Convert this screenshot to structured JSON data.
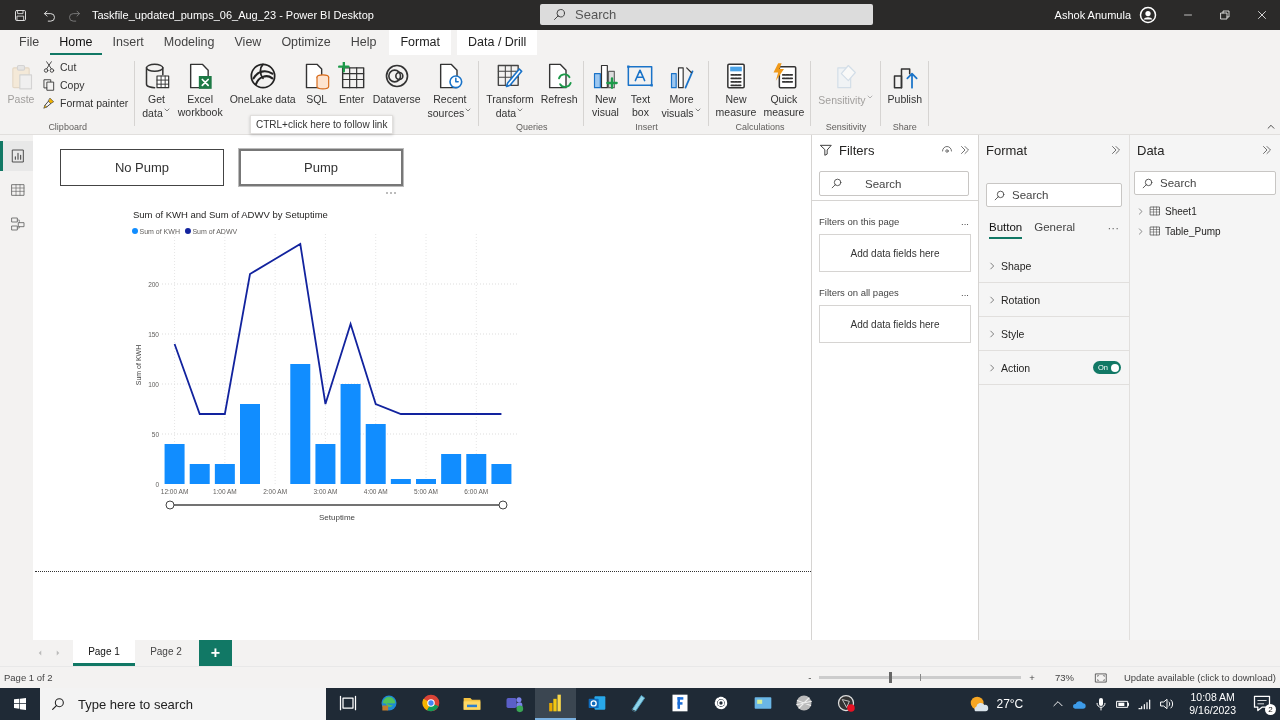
{
  "window": {
    "title": "Taskfile_updated_pumps_06_Aug_23 - Power BI Desktop",
    "search_placeholder": "Search",
    "user": "Ashok Anumula"
  },
  "menu_tabs": [
    {
      "label": "File",
      "selected": false,
      "kind": "plain"
    },
    {
      "label": "Home",
      "selected": true,
      "kind": "plain"
    },
    {
      "label": "Insert",
      "selected": false,
      "kind": "plain"
    },
    {
      "label": "Modeling",
      "selected": false,
      "kind": "plain"
    },
    {
      "label": "View",
      "selected": false,
      "kind": "plain"
    },
    {
      "label": "Optimize",
      "selected": false,
      "kind": "plain"
    },
    {
      "label": "Help",
      "selected": false,
      "kind": "plain"
    },
    {
      "label": "Format",
      "selected": false,
      "kind": "contextual"
    },
    {
      "label": "Data / Drill",
      "selected": false,
      "kind": "contextual"
    }
  ],
  "ribbon": {
    "groups": [
      {
        "label": "Clipboard",
        "buttons": [
          {
            "label": "Paste",
            "kind": "large",
            "disabled": true,
            "dropdown": false
          },
          {
            "label": "Cut",
            "kind": "small",
            "disabled": false,
            "dropdown": false
          },
          {
            "label": "Copy",
            "kind": "small",
            "disabled": false,
            "dropdown": false
          },
          {
            "label": "Format painter",
            "kind": "small",
            "disabled": false,
            "dropdown": false
          }
        ]
      },
      {
        "buttons": [
          {
            "label": "Get\ndata",
            "kind": "large",
            "disabled": false,
            "dropdown": true
          },
          {
            "label": "Excel\nworkbook",
            "kind": "large",
            "disabled": false,
            "dropdown": false
          },
          {
            "label": "OneLake data",
            "kind": "large",
            "disabled": false,
            "dropdown": false
          },
          {
            "label": "SQL",
            "kind": "large",
            "disabled": false,
            "dropdown": false
          },
          {
            "label": "Enter",
            "kind": "large",
            "disabled": false,
            "dropdown": false
          },
          {
            "label": "Dataverse",
            "kind": "large",
            "disabled": false,
            "dropdown": false
          },
          {
            "label": "Recent\nsources",
            "kind": "large",
            "disabled": false,
            "dropdown": true
          }
        ]
      },
      {
        "label": "Queries",
        "buttons": [
          {
            "label": "Transform\ndata",
            "kind": "large",
            "disabled": false,
            "dropdown": true
          },
          {
            "label": "Refresh",
            "kind": "large",
            "disabled": false,
            "dropdown": false
          }
        ]
      },
      {
        "label": "Insert",
        "buttons": [
          {
            "label": "New\nvisual",
            "kind": "large",
            "disabled": false,
            "dropdown": false
          },
          {
            "label": "Text\nbox",
            "kind": "large",
            "disabled": false,
            "dropdown": false
          },
          {
            "label": "More\nvisuals",
            "kind": "large",
            "disabled": false,
            "dropdown": true
          }
        ]
      },
      {
        "label": "Calculations",
        "buttons": [
          {
            "label": "New\nmeasure",
            "kind": "large",
            "disabled": false,
            "dropdown": false
          },
          {
            "label": "Quick\nmeasure",
            "kind": "large",
            "disabled": false,
            "dropdown": false
          }
        ]
      },
      {
        "label": "Sensitivity",
        "buttons": [
          {
            "label": "Sensitivity",
            "kind": "large",
            "disabled": true,
            "dropdown": true
          }
        ]
      },
      {
        "label": "Share",
        "buttons": [
          {
            "label": "Publish",
            "kind": "large",
            "disabled": false,
            "dropdown": false
          }
        ]
      }
    ]
  },
  "tooltip": "CTRL+click here to follow link",
  "views": [
    {
      "selected": true
    },
    {
      "selected": false
    },
    {
      "selected": false
    }
  ],
  "report": {
    "buttons": [
      {
        "label": "No Pump",
        "selected": false
      },
      {
        "label": "Pump",
        "selected": true
      }
    ],
    "chart": {
      "chart_data": {
        "type": "bar",
        "title": "Sum of KWH and Sum of ADWV by Setuptime",
        "xlabel": "Setuptime",
        "ylabel": "Sum of KWH",
        "x": [
          0,
          30,
          60,
          90,
          120,
          150,
          180,
          210,
          240,
          270,
          300,
          330,
          360,
          390
        ],
        "series": [
          {
            "name": "Sum of KWH",
            "type": "bar",
            "color": "#118dff",
            "values": [
              40,
              20,
              20,
              80,
              null,
              120,
              40,
              100,
              60,
              5,
              5,
              30,
              30,
              20
            ]
          },
          {
            "name": "Sum of ADWV",
            "type": "line",
            "color": "#12239e",
            "values": [
              140,
              70,
              70,
              210,
              225,
              240,
              80,
              160,
              80,
              70,
              70,
              70,
              70,
              70
            ]
          }
        ],
        "xlim": [
          -15,
          405
        ],
        "ylim": [
          0,
          250
        ],
        "yticks": [
          0,
          50,
          100,
          150,
          200
        ],
        "grid": true,
        "legend": true,
        "xticks": [
          {
            "value": 0,
            "label": "12:00 AM"
          },
          {
            "value": 60,
            "label": "1:00 AM"
          },
          {
            "value": 120,
            "label": "2:00 AM"
          },
          {
            "value": 180,
            "label": "3:00 AM"
          },
          {
            "value": 240,
            "label": "4:00 AM"
          },
          {
            "value": 300,
            "label": "5:00 AM"
          },
          {
            "value": 360,
            "label": "6:00 AM"
          }
        ]
      }
    }
  },
  "filters": {
    "title": "Filters",
    "search_placeholder": "Search",
    "sections": [
      {
        "title": "Filters on this page",
        "more": "...",
        "drop_hint": "Add data fields here"
      },
      {
        "title": "Filters on all pages",
        "more": "...",
        "drop_hint": "Add data fields here"
      }
    ]
  },
  "format": {
    "title": "Format",
    "search_placeholder": "Search",
    "tabs": [
      {
        "label": "Button",
        "selected": true
      },
      {
        "label": "General",
        "selected": false
      }
    ],
    "more": "···",
    "sections": [
      {
        "label": "Shape",
        "kind": "plain"
      },
      {
        "label": "Rotation",
        "kind": "plain"
      },
      {
        "label": "Style",
        "kind": "plain"
      },
      {
        "label": "Action",
        "kind": "toggle",
        "toggle": {
          "on": true,
          "label": "On"
        }
      }
    ]
  },
  "data_pane": {
    "title": "Data",
    "search_placeholder": "Search",
    "tables": [
      {
        "name": "Sheet1",
        "expanded": false
      },
      {
        "name": "Table_Pump",
        "expanded": false
      }
    ]
  },
  "page_tabs": [
    {
      "label": "Page 1",
      "selected": true
    },
    {
      "label": "Page 2",
      "selected": false
    }
  ],
  "add_page": "+",
  "status_bar": {
    "page_info": "Page 1 of 2",
    "zoom_minus": "-",
    "zoom_plus": "+",
    "zoom": {
      "level": 0.35
    },
    "zoom_percent": "73%",
    "update_notice": "Update available (click to download)"
  },
  "taskbar": {
    "search_placeholder": "Type here to search",
    "apps": [
      {
        "selected": false
      },
      {
        "selected": false
      },
      {
        "selected": false
      },
      {
        "selected": false
      },
      {
        "selected": false
      },
      {
        "selected": true
      },
      {
        "selected": false
      },
      {
        "selected": false
      },
      {
        "selected": false
      },
      {
        "selected": false
      },
      {
        "selected": false
      },
      {
        "selected": false
      },
      {
        "selected": false
      }
    ],
    "weather": "27°C",
    "time": "10:08 AM",
    "date": "9/16/2023",
    "notifications": "2"
  }
}
